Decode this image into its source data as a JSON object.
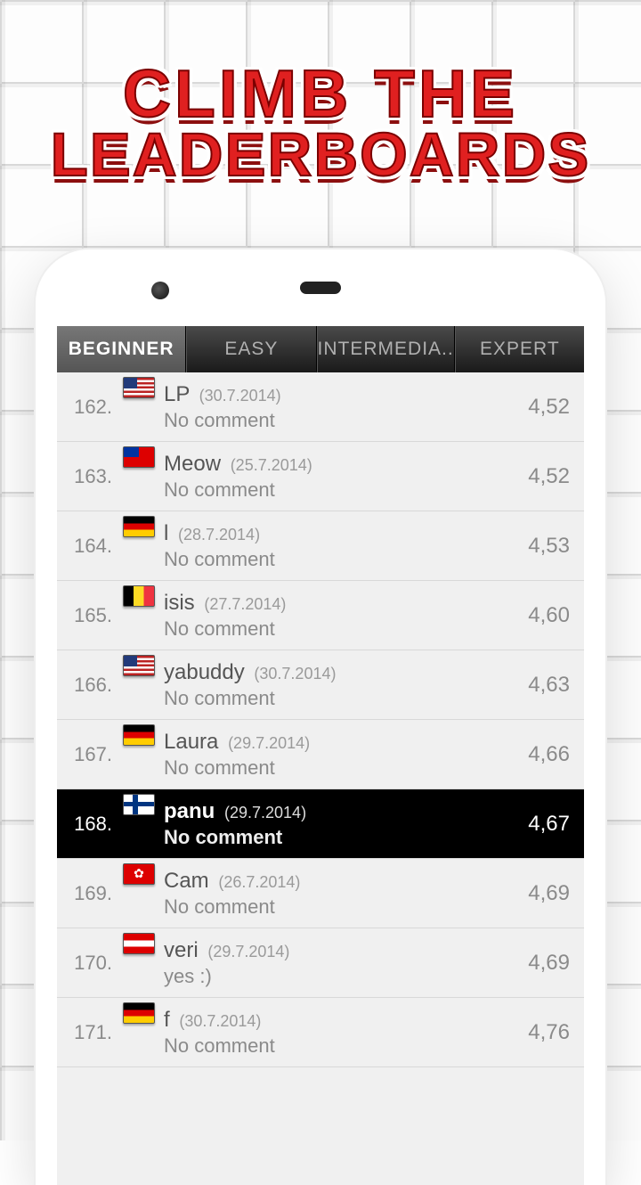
{
  "headline": {
    "line1": "CLIMB THE",
    "line2": "LEADERBOARDS"
  },
  "tabs": [
    {
      "label": "BEGINNER",
      "active": true
    },
    {
      "label": "EASY",
      "active": false
    },
    {
      "label": "INTERMEDIA..",
      "active": false
    },
    {
      "label": "EXPERT",
      "active": false
    }
  ],
  "rows": [
    {
      "rank": "162.",
      "flag": "us",
      "name": "LP",
      "date": "(30.7.2014)",
      "comment": "No comment",
      "score": "4,52",
      "hl": false
    },
    {
      "rank": "163.",
      "flag": "tw",
      "name": "Meow",
      "date": "(25.7.2014)",
      "comment": "No comment",
      "score": "4,52",
      "hl": false
    },
    {
      "rank": "164.",
      "flag": "de",
      "name": "l",
      "date": "(28.7.2014)",
      "comment": "No comment",
      "score": "4,53",
      "hl": false
    },
    {
      "rank": "165.",
      "flag": "be",
      "name": "isis",
      "date": "(27.7.2014)",
      "comment": "No comment",
      "score": "4,60",
      "hl": false
    },
    {
      "rank": "166.",
      "flag": "us",
      "name": "yabuddy",
      "date": "(30.7.2014)",
      "comment": "No comment",
      "score": "4,63",
      "hl": false
    },
    {
      "rank": "167.",
      "flag": "de",
      "name": "Laura",
      "date": "(29.7.2014)",
      "comment": "No comment",
      "score": "4,66",
      "hl": false
    },
    {
      "rank": "168.",
      "flag": "fi",
      "name": "panu",
      "date": "(29.7.2014)",
      "comment": "No comment",
      "score": "4,67",
      "hl": true
    },
    {
      "rank": "169.",
      "flag": "hk",
      "name": "Cam",
      "date": "(26.7.2014)",
      "comment": "No comment",
      "score": "4,69",
      "hl": false
    },
    {
      "rank": "170.",
      "flag": "at",
      "name": "veri",
      "date": "(29.7.2014)",
      "comment": "yes :)",
      "score": "4,69",
      "hl": false
    },
    {
      "rank": "171.",
      "flag": "de",
      "name": "f",
      "date": "(30.7.2014)",
      "comment": "No comment",
      "score": "4,76",
      "hl": false
    }
  ]
}
